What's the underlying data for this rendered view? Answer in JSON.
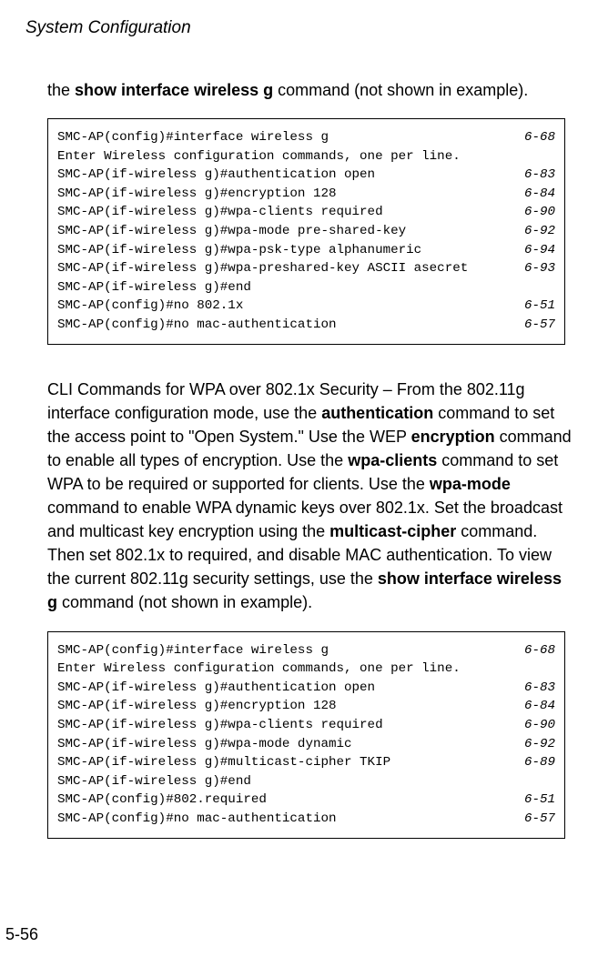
{
  "header": {
    "title": "System Configuration"
  },
  "intro": {
    "prefix": "the ",
    "bold1": "show interface wireless g",
    "suffix": " command (not shown in example)."
  },
  "cli1": {
    "lines": [
      {
        "cmd": "SMC-AP(config)#interface wireless g",
        "ref": "6-68"
      },
      {
        "cmd": "Enter Wireless configuration commands, one per line.",
        "ref": ""
      },
      {
        "cmd": "SMC-AP(if-wireless g)#authentication open",
        "ref": "6-83"
      },
      {
        "cmd": "SMC-AP(if-wireless g)#encryption 128",
        "ref": "6-84"
      },
      {
        "cmd": "SMC-AP(if-wireless g)#wpa-clients required",
        "ref": "6-90"
      },
      {
        "cmd": "SMC-AP(if-wireless g)#wpa-mode pre-shared-key",
        "ref": "6-92"
      },
      {
        "cmd": "SMC-AP(if-wireless g)#wpa-psk-type alphanumeric",
        "ref": "6-94"
      },
      {
        "cmd": "SMC-AP(if-wireless g)#wpa-preshared-key ASCII asecret",
        "ref": "6-93"
      },
      {
        "cmd": "SMC-AP(if-wireless g)#end",
        "ref": ""
      },
      {
        "cmd": "SMC-AP(config)#no 802.1x",
        "ref": "6-51"
      },
      {
        "cmd": "SMC-AP(config)#no mac-authentication",
        "ref": "6-57"
      }
    ]
  },
  "para2": {
    "t1": "CLI Commands for WPA over 802.1x Security – From the 802.11g interface configuration mode, use the ",
    "b1": "authentication",
    "t2": " command to set the access point to \"Open System.\" Use the WEP ",
    "b2": "encryption",
    "t3": " command to enable all types of encryption. Use the ",
    "b3": "wpa-clients",
    "t4": " command to set WPA to be required or supported for clients. Use the ",
    "b4": "wpa-mode",
    "t5": " command to enable WPA dynamic keys over 802.1x. Set the broadcast and multicast key encryption using the ",
    "b5": "multicast-cipher",
    "t6": " command. Then set 802.1x to required, and disable MAC authentication. To view the current 802.11g security settings, use the ",
    "b6": "show interface wireless g",
    "t7": " command (not shown in example)."
  },
  "cli2": {
    "lines": [
      {
        "cmd": "SMC-AP(config)#interface wireless g",
        "ref": "6-68"
      },
      {
        "cmd": "Enter Wireless configuration commands, one per line.",
        "ref": ""
      },
      {
        "cmd": "SMC-AP(if-wireless g)#authentication open",
        "ref": "6-83"
      },
      {
        "cmd": "SMC-AP(if-wireless g)#encryption 128",
        "ref": "6-84"
      },
      {
        "cmd": "SMC-AP(if-wireless g)#wpa-clients required",
        "ref": "6-90"
      },
      {
        "cmd": "SMC-AP(if-wireless g)#wpa-mode dynamic",
        "ref": "6-92"
      },
      {
        "cmd": "SMC-AP(if-wireless g)#multicast-cipher TKIP",
        "ref": "6-89"
      },
      {
        "cmd": "SMC-AP(if-wireless g)#end",
        "ref": ""
      },
      {
        "cmd": "SMC-AP(config)#802.required",
        "ref": "6-51"
      },
      {
        "cmd": "SMC-AP(config)#no mac-authentication",
        "ref": "6-57"
      }
    ]
  },
  "footer": {
    "page_number": "5-56"
  }
}
